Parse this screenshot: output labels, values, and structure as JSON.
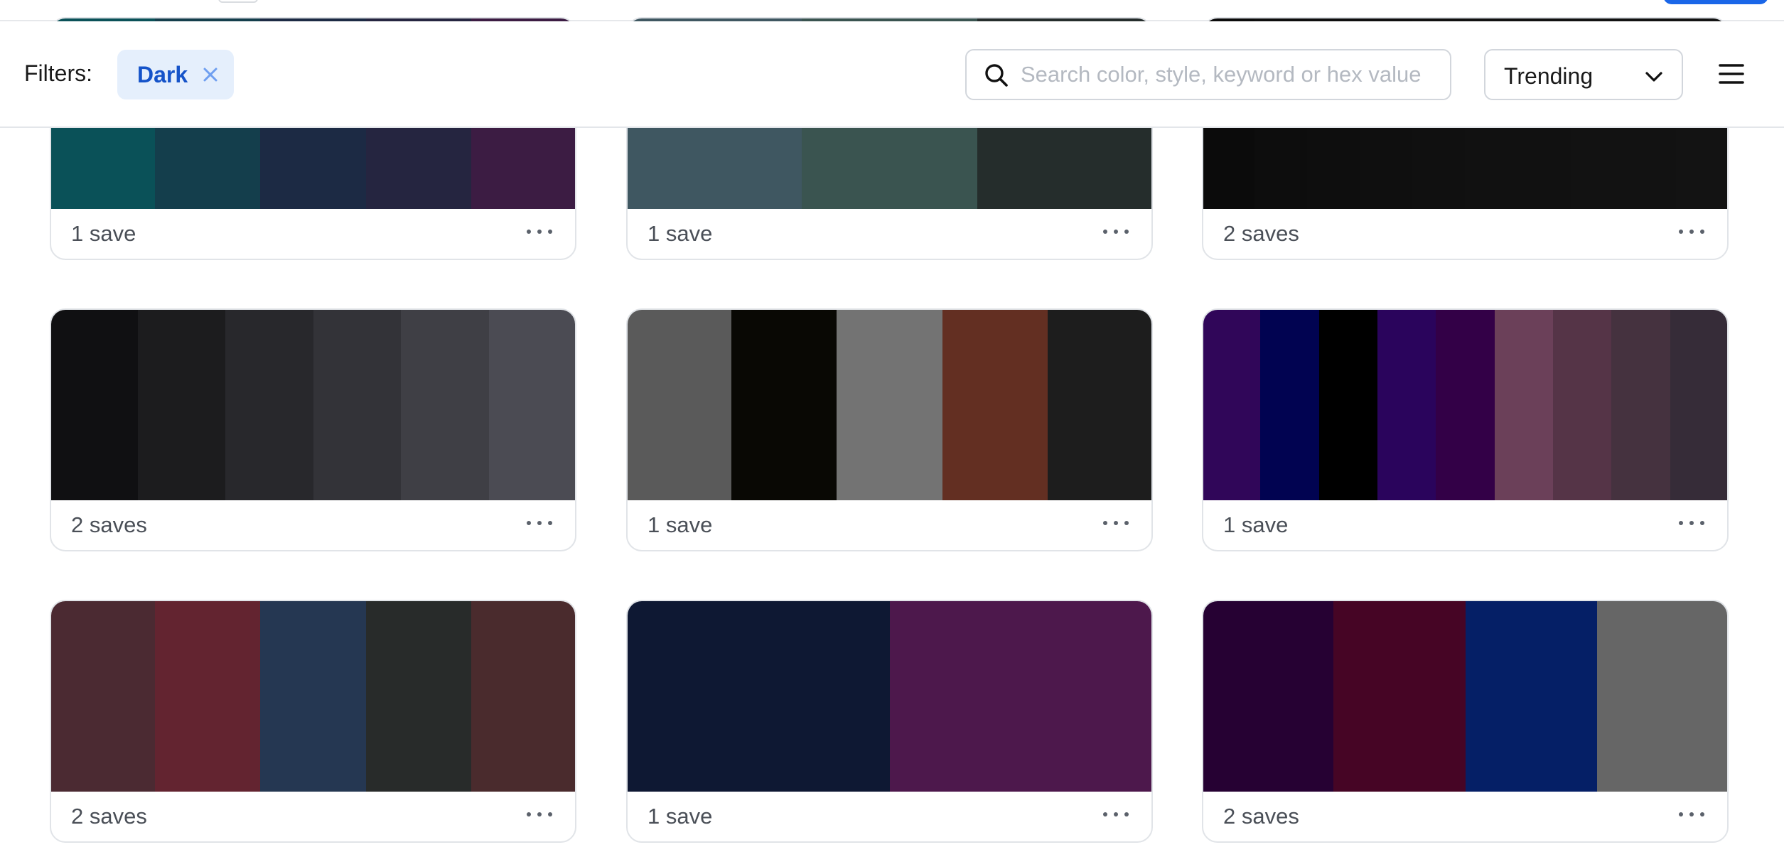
{
  "filter_bar": {
    "label": "Filters:",
    "chips": [
      {
        "label": "Dark"
      }
    ],
    "search": {
      "placeholder": "Search color, style, keyword or hex value",
      "value": ""
    },
    "sort": {
      "selected": "Trending"
    }
  },
  "icons": {
    "search": "search-icon",
    "chip_close": "close-icon",
    "sort_caret": "chevron-down-icon",
    "menu": "hamburger-menu-icon",
    "card_more": "more-horizontal-icon"
  },
  "accent_color": "#1a66e8",
  "palettes": [
    {
      "saves": "1 save",
      "colors": [
        "#0a5158",
        "#143e4c",
        "#1c2a44",
        "#252540",
        "#3c1c43"
      ]
    },
    {
      "saves": "1 save",
      "colors": [
        "#3f5761",
        "#3a5450",
        "#252d2c"
      ]
    },
    {
      "saves": "2 saves",
      "colors": [
        "#0b0b0b",
        "#0d0d0d",
        "#0e0e0e",
        "#0f0f0f",
        "#101010",
        "#111111",
        "#111111",
        "#121212",
        "#121212",
        "#131313"
      ]
    },
    {
      "saves": "2 saves",
      "colors": [
        "#101012",
        "#1c1c1e",
        "#28282c",
        "#333338",
        "#3f3f45",
        "#4b4b53"
      ]
    },
    {
      "saves": "1 save",
      "colors": [
        "#5a5a5a",
        "#090804",
        "#737373",
        "#632f22",
        "#1d1d1d"
      ]
    },
    {
      "saves": "1 save",
      "colors": [
        "#300659",
        "#010351",
        "#000000",
        "#2a045c",
        "#330047",
        "#6b4059",
        "#553447",
        "#45323f",
        "#362c38"
      ]
    },
    {
      "saves": "2 saves",
      "colors": [
        "#4b2a32",
        "#632430",
        "#253752",
        "#282b2a",
        "#4a2b2d"
      ]
    },
    {
      "saves": "1 save",
      "colors": [
        "#0e1833",
        "#4d184c"
      ]
    },
    {
      "saves": "2 saves",
      "colors": [
        "#260133",
        "#460525",
        "#051f66",
        "#666666"
      ]
    }
  ]
}
